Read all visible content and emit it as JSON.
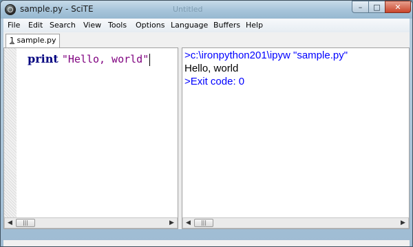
{
  "window": {
    "title": "sample.py - SciTE",
    "background_caption": "Untitled",
    "controls": {
      "minimize": "–",
      "maximize": "□",
      "close": "✕"
    }
  },
  "menubar": {
    "items": [
      "File",
      "Edit",
      "Search",
      "View",
      "Tools",
      "Options",
      "Language",
      "Buffers",
      "Help"
    ]
  },
  "tabs": [
    {
      "number": "1",
      "label": " sample.py"
    }
  ],
  "editor": {
    "keyword": "print",
    "string": "\"Hello, world\""
  },
  "output": {
    "lines": [
      {
        "text": ">c:\\ironpython201\\ipyw \"sample.py\"",
        "color": "#0000ff"
      },
      {
        "text": "Hello, world",
        "color": "#000000"
      },
      {
        "text": ">Exit code: 0",
        "color": "#0000ff"
      }
    ]
  },
  "scrollbar": {
    "left_arrow": "◀",
    "right_arrow": "▶",
    "grip": "|||"
  },
  "icons": [
    "scite-app-icon",
    "minimize-icon",
    "maximize-icon",
    "close-icon",
    "scroll-left-icon",
    "scroll-right-icon"
  ]
}
